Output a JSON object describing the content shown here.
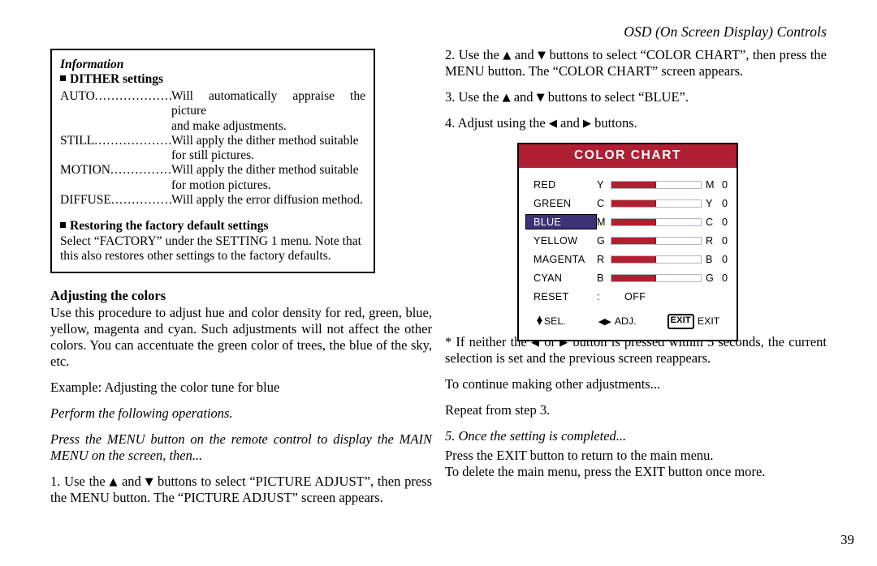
{
  "running_head": "OSD (On Screen Display) Controls",
  "page_number": "39",
  "info_box": {
    "title": "Information",
    "subtitle": "DITHER settings",
    "dither_items": [
      {
        "term": "AUTO",
        "dots": "....................",
        "definition": "Will automatically appraise the picture",
        "continuation": "and make adjustments."
      },
      {
        "term": "STILL",
        "dots": "....................",
        "definition": "Will apply the dither method suitable",
        "continuation": "for still pictures."
      },
      {
        "term": "MOTION",
        "dots": "................",
        "definition": "Will apply the dither method suitable",
        "continuation": "for motion pictures."
      },
      {
        "term": "DIFFUSE",
        "dots": "...............",
        "definition": "Will apply the error diffusion method.",
        "continuation": ""
      }
    ],
    "factory_heading": "Restoring the factory default settings",
    "factory_line1": "Select “FACTORY” under the SETTING 1 menu. Note that",
    "factory_line2": "this also restores other settings to the factory defaults."
  },
  "left_column": {
    "heading": "Adjusting the colors",
    "paragraph": "Use this procedure to adjust hue and color density for red, green, blue, yellow, magenta and cyan. Such adjustments will not affect the other colors. You can accentuate the green color of trees, the blue of the sky, etc.",
    "example": "Example: Adjusting the color tune for blue",
    "perform": "Perform the following operations.",
    "press_menu": "Press the MENU button on the remote control to display the MAIN MENU on the screen, then...",
    "step1_a": "1. Use the ",
    "step1_b": " and ",
    "step1_c": " buttons to select “PICTURE ADJUST”, then press the MENU button. The “PICTURE ADJUST” screen appears."
  },
  "right_column": {
    "step2_a": "2. Use the ",
    "step2_b": " and ",
    "step2_c": " buttons to select “COLOR CHART”, then press the MENU button. The “COLOR CHART” screen appears.",
    "step3_a": "3. Use the ",
    "step3_b": " and ",
    "step3_c": " buttons to select “BLUE”.",
    "step4_a": "4. Adjust using the ",
    "step4_b": " and ",
    "step4_c": " buttons.",
    "note_a": "* If neither the ",
    "note_b": " or ",
    "note_c": " button is pressed within 5 seconds, the current selection is set and the previous screen reappears.",
    "continue_text": "To continue making other adjustments...",
    "repeat_text": "Repeat from step 3.",
    "step5_heading": "5. Once the setting is completed...",
    "step5_line1": "Press the EXIT button to return to the main menu.",
    "step5_line2": "To delete the main menu, press the EXIT button once more."
  },
  "icons": {
    "up": "▲",
    "down": "▼",
    "left": "◀",
    "right": "▶",
    "updown": "↕",
    "leftright": "◀▶"
  },
  "osd": {
    "title": "COLOR CHART",
    "header_color": "#AF1E32",
    "selected_color": "#3B3278",
    "bar_fill_color": "#B21F30",
    "bar_track_color": "#BAB2C8",
    "rows": [
      {
        "label": "RED",
        "left_axis": "Y",
        "right_axis": "M",
        "value": "0",
        "fill_percent": 50,
        "selected": false
      },
      {
        "label": "GREEN",
        "left_axis": "C",
        "right_axis": "Y",
        "value": "0",
        "fill_percent": 50,
        "selected": false
      },
      {
        "label": "BLUE",
        "left_axis": "M",
        "right_axis": "C",
        "value": "0",
        "fill_percent": 50,
        "selected": true
      },
      {
        "label": "YELLOW",
        "left_axis": "G",
        "right_axis": "R",
        "value": "0",
        "fill_percent": 50,
        "selected": false
      },
      {
        "label": "MAGENTA",
        "left_axis": "R",
        "right_axis": "B",
        "value": "0",
        "fill_percent": 50,
        "selected": false
      },
      {
        "label": "CYAN",
        "left_axis": "B",
        "right_axis": "G",
        "value": "0",
        "fill_percent": 50,
        "selected": false
      }
    ],
    "reset": {
      "label": "RESET",
      "colon": ":",
      "value": "OFF"
    },
    "footer": {
      "sel_label": "SEL.",
      "adj_label": "ADJ.",
      "exit_key": "EXIT",
      "exit_label": "EXIT"
    }
  }
}
